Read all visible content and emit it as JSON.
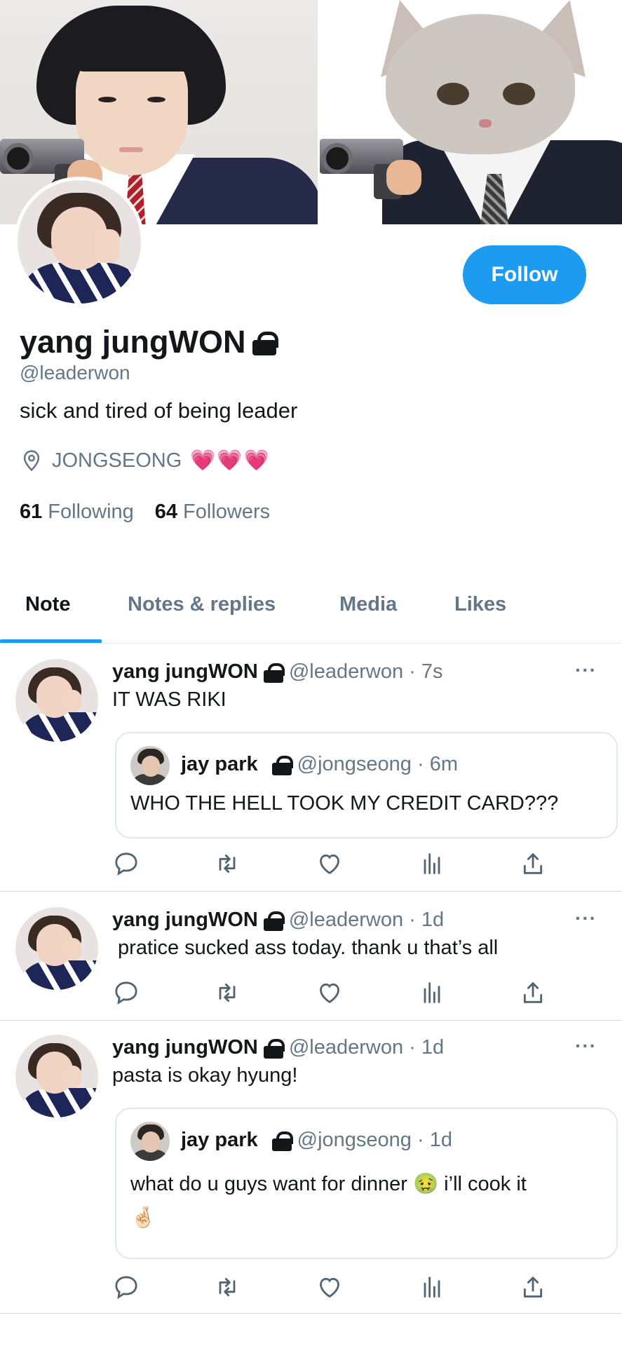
{
  "profile": {
    "display_name": "yang jungWON",
    "handle": "@leaderwon",
    "bio": "sick and tired of being leader",
    "location": "JONGSEONG",
    "location_emoji": "💗💗💗",
    "following_count": "61",
    "following_label": "Following",
    "followers_count": "64",
    "followers_label": "Followers",
    "follow_button": "Follow"
  },
  "tabs": [
    {
      "label": "Note",
      "active": true
    },
    {
      "label": "Notes & replies",
      "active": false
    },
    {
      "label": "Media",
      "active": false
    },
    {
      "label": "Likes",
      "active": false
    }
  ],
  "posts": [
    {
      "name": "yang jungWON",
      "meta": "@leaderwon · 7s",
      "text": "IT WAS RIKI",
      "quote": {
        "name": "jay park",
        "meta": "@jongseong · 6m",
        "text": "WHO THE HELL TOOK MY CREDIT CARD???"
      }
    },
    {
      "name": "yang jungWON",
      "meta": "@leaderwon · 1d",
      "text": " pratice sucked ass today. thank u that’s all"
    },
    {
      "name": "yang jungWON",
      "meta": "@leaderwon · 1d",
      "text": "pasta is okay hyung!",
      "quote": {
        "name": "jay park",
        "meta": "@jongseong · 1d",
        "text_line1": "what do u guys want for dinner 🤢 i’ll cook it",
        "text_line2": "🤞🏻"
      }
    }
  ],
  "more_icon": "···",
  "icons": [
    "location-pin-icon",
    "lock-icon",
    "reply-icon",
    "retweet-icon",
    "like-icon",
    "stats-icon",
    "share-icon",
    "more-icon"
  ],
  "colors": {
    "accent": "#1d9bf0",
    "muted": "#657786",
    "text": "#14171a"
  }
}
